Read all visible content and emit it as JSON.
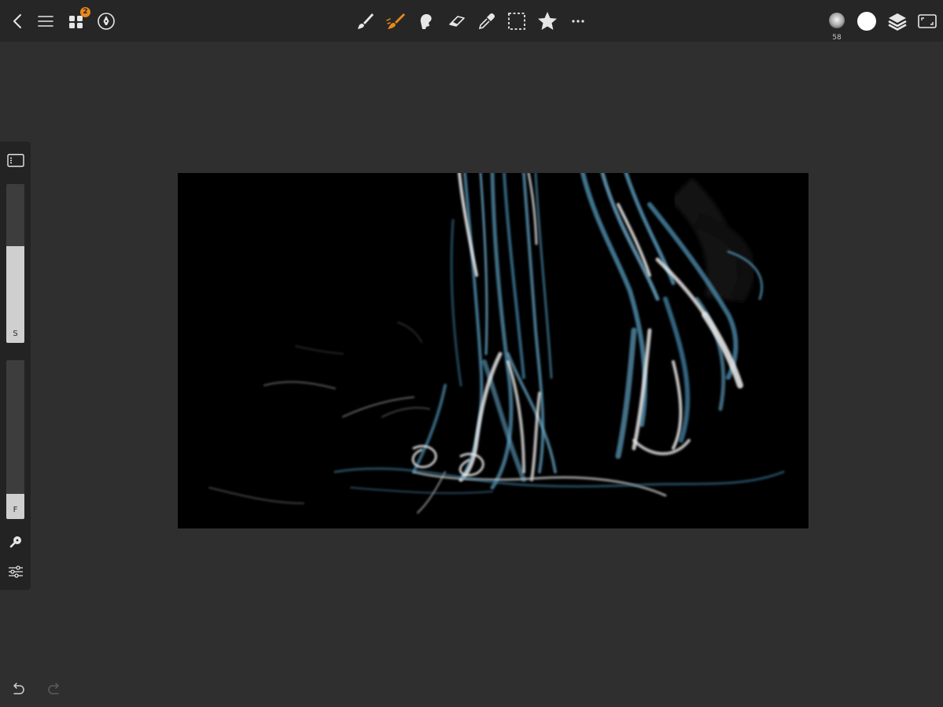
{
  "app": {
    "notification_count": "2",
    "accent_color": "#e8871e"
  },
  "toolbar": {
    "left_icons": [
      "back-chevron-icon",
      "menu-icon",
      "gallery-grid-icon",
      "pen-nib-circle-icon"
    ],
    "center_icons": [
      "brush-icon",
      "paint-brush-icon",
      "smudge-icon",
      "eraser-icon",
      "eyedropper-icon",
      "selection-icon",
      "star-icon",
      "more-icon"
    ],
    "active_tool": "paint-brush-icon",
    "right_icons": [
      "brush-preview-icon",
      "color-swatch-icon",
      "layers-icon",
      "fullscreen-icon"
    ],
    "brush_size": "58",
    "current_color": "#ffffff"
  },
  "sidebar": {
    "size_slider": {
      "label": "S",
      "value_fraction": 0.61
    },
    "flow_slider": {
      "label": "F",
      "value_fraction": 0.16
    },
    "icons": [
      "panel-toggle-icon",
      "eyedropper-key-icon",
      "sliders-icon"
    ]
  },
  "history": {
    "undo_enabled": true,
    "redo_enabled": false
  }
}
